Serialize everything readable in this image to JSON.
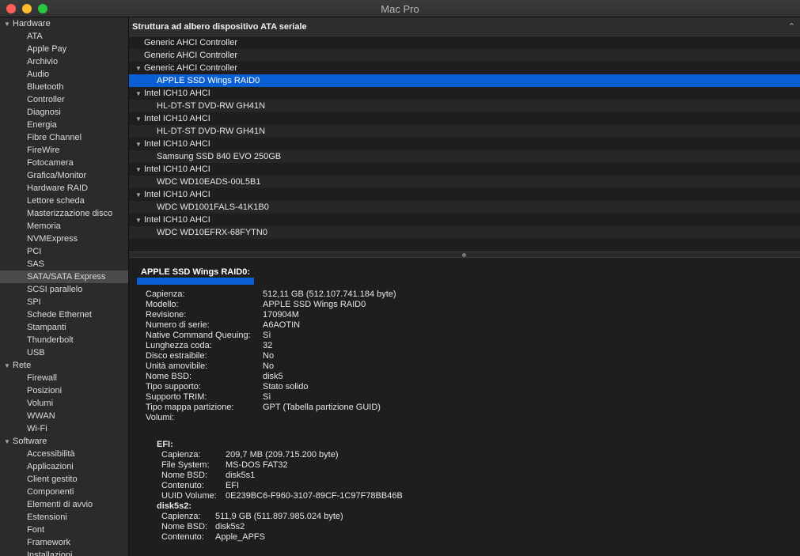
{
  "window": {
    "title": "Mac Pro"
  },
  "sidebar": {
    "sections": [
      {
        "label": "Hardware",
        "items": [
          "ATA",
          "Apple Pay",
          "Archivio",
          "Audio",
          "Bluetooth",
          "Controller",
          "Diagnosi",
          "Energia",
          "Fibre Channel",
          "FireWire",
          "Fotocamera",
          "Grafica/Monitor",
          "Hardware RAID",
          "Lettore scheda",
          "Masterizzazione disco",
          "Memoria",
          "NVMExpress",
          "PCI",
          "SAS",
          "SATA/SATA Express",
          "SCSI parallelo",
          "SPI",
          "Schede Ethernet",
          "Stampanti",
          "Thunderbolt",
          "USB"
        ]
      },
      {
        "label": "Rete",
        "items": [
          "Firewall",
          "Posizioni",
          "Volumi",
          "WWAN",
          "Wi-Fi"
        ]
      },
      {
        "label": "Software",
        "items": [
          "Accessibilità",
          "Applicazioni",
          "Client gestito",
          "Componenti",
          "Elementi di avvio",
          "Estensioni",
          "Font",
          "Framework",
          "Installazioni"
        ]
      }
    ],
    "selected": "SATA/SATA Express"
  },
  "tree": {
    "header": "Struttura ad albero dispositivo ATA seriale",
    "rows": [
      {
        "label": "Generic AHCI Controller",
        "level": 0,
        "expanded": false
      },
      {
        "label": "Generic AHCI Controller",
        "level": 0,
        "expanded": false
      },
      {
        "label": "Generic AHCI Controller",
        "level": 0,
        "expanded": true
      },
      {
        "label": "APPLE SSD Wings RAID0",
        "level": 1,
        "selected": true
      },
      {
        "label": "Intel ICH10 AHCI",
        "level": 0,
        "expanded": true
      },
      {
        "label": "HL-DT-ST DVD-RW GH41N",
        "level": 1
      },
      {
        "label": "Intel ICH10 AHCI",
        "level": 0,
        "expanded": true
      },
      {
        "label": "HL-DT-ST DVD-RW GH41N",
        "level": 1
      },
      {
        "label": "Intel ICH10 AHCI",
        "level": 0,
        "expanded": true
      },
      {
        "label": "Samsung SSD 840 EVO 250GB",
        "level": 1
      },
      {
        "label": "Intel ICH10 AHCI",
        "level": 0,
        "expanded": true
      },
      {
        "label": "WDC WD10EADS-00L5B1",
        "level": 1
      },
      {
        "label": "Intel ICH10 AHCI",
        "level": 0,
        "expanded": true
      },
      {
        "label": "WDC WD1001FALS-41K1B0",
        "level": 1
      },
      {
        "label": "Intel ICH10 AHCI",
        "level": 0,
        "expanded": true
      },
      {
        "label": "WDC WD10EFRX-68FYTN0",
        "level": 1
      }
    ]
  },
  "details": {
    "title": "APPLE SSD Wings RAID0:",
    "fields": [
      {
        "k": "Capienza:",
        "v": "512,11 GB (512.107.741.184 byte)"
      },
      {
        "k": "Modello:",
        "v": "APPLE SSD Wings RAID0"
      },
      {
        "k": "Revisione:",
        "v": "170904M"
      },
      {
        "k": "Numero di serie:",
        "v": "A6AOTIN"
      },
      {
        "k": "Native Command Queuing:",
        "v": "Sì"
      },
      {
        "k": "Lunghezza coda:",
        "v": "32"
      },
      {
        "k": "Disco estraibile:",
        "v": "No"
      },
      {
        "k": "Unità amovibile:",
        "v": "No"
      },
      {
        "k": "Nome BSD:",
        "v": "disk5"
      },
      {
        "k": "Tipo supporto:",
        "v": "Stato solido"
      },
      {
        "k": "Supporto TRIM:",
        "v": "Sì"
      },
      {
        "k": "Tipo mappa partizione:",
        "v": "GPT (Tabella partizione GUID)"
      },
      {
        "k": "Volumi:",
        "v": ""
      }
    ],
    "volumes": [
      {
        "name": "EFI:",
        "fields": [
          {
            "k": "Capienza:",
            "v": "209,7 MB (209.715.200 byte)"
          },
          {
            "k": "File System:",
            "v": "MS-DOS FAT32"
          },
          {
            "k": "Nome BSD:",
            "v": "disk5s1"
          },
          {
            "k": "Contenuto:",
            "v": "EFI"
          },
          {
            "k": "UUID Volume:",
            "v": "0E239BC6-F960-3107-89CF-1C97F78BB46B"
          }
        ]
      },
      {
        "name": "disk5s2:",
        "fields": [
          {
            "k": "Capienza:",
            "v": "511,9 GB (511.897.985.024 byte)"
          },
          {
            "k": "Nome BSD:",
            "v": "disk5s2"
          },
          {
            "k": "Contenuto:",
            "v": "Apple_APFS"
          }
        ]
      }
    ]
  }
}
